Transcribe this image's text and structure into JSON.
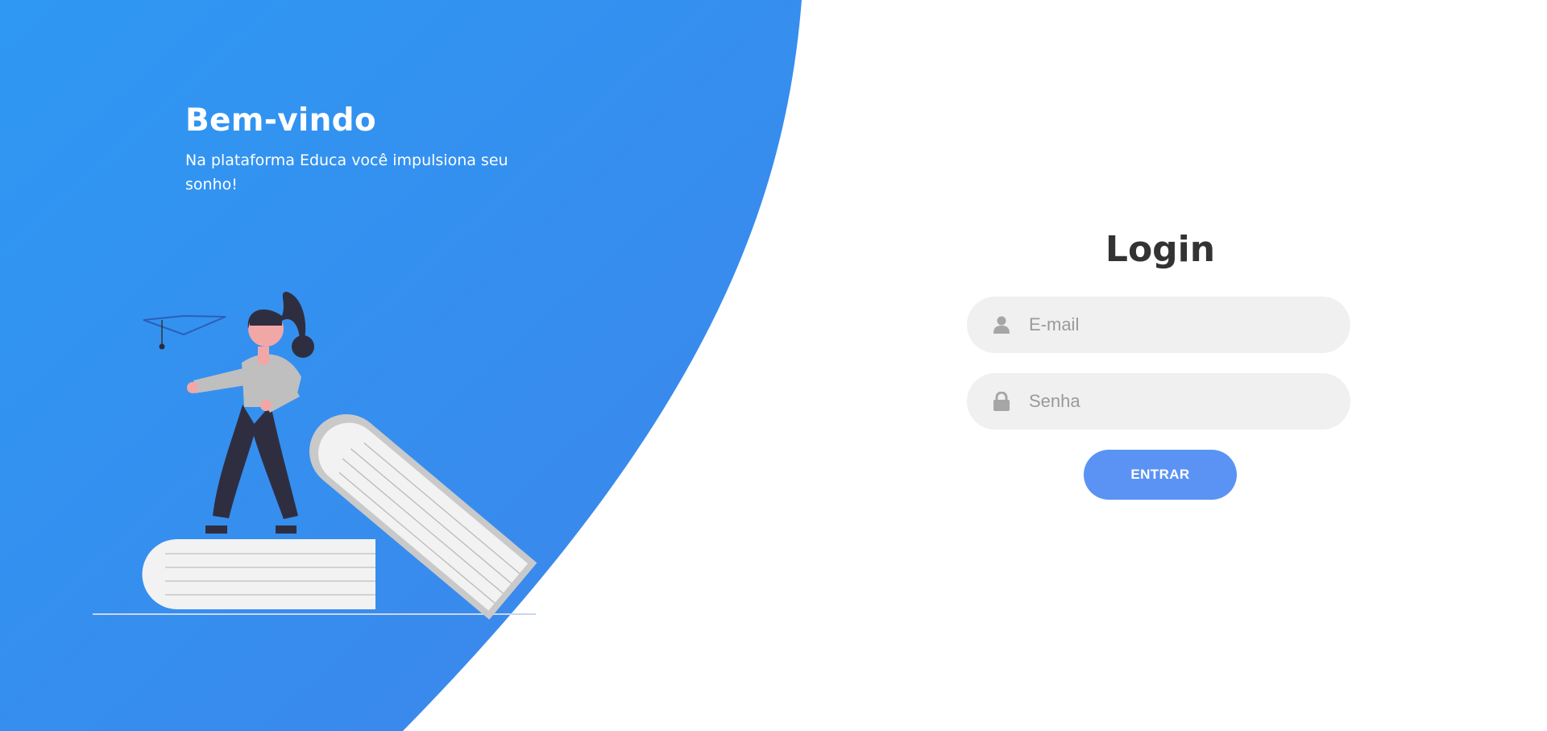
{
  "welcome": {
    "title": "Bem-vindo",
    "subtitle": "Na plataforma Educa você impulsiona seu sonho!"
  },
  "login": {
    "title": "Login",
    "email_placeholder": "E-mail",
    "password_placeholder": "Senha",
    "submit_label": "ENTRAR"
  },
  "icons": {
    "email": "user-icon",
    "password": "lock-icon"
  },
  "colors": {
    "primary_gradient_start": "#2e98f3",
    "primary_gradient_end": "#3d85ea",
    "button": "#5b93f5",
    "input_bg": "#f0f0f0",
    "title_text": "#333333"
  }
}
